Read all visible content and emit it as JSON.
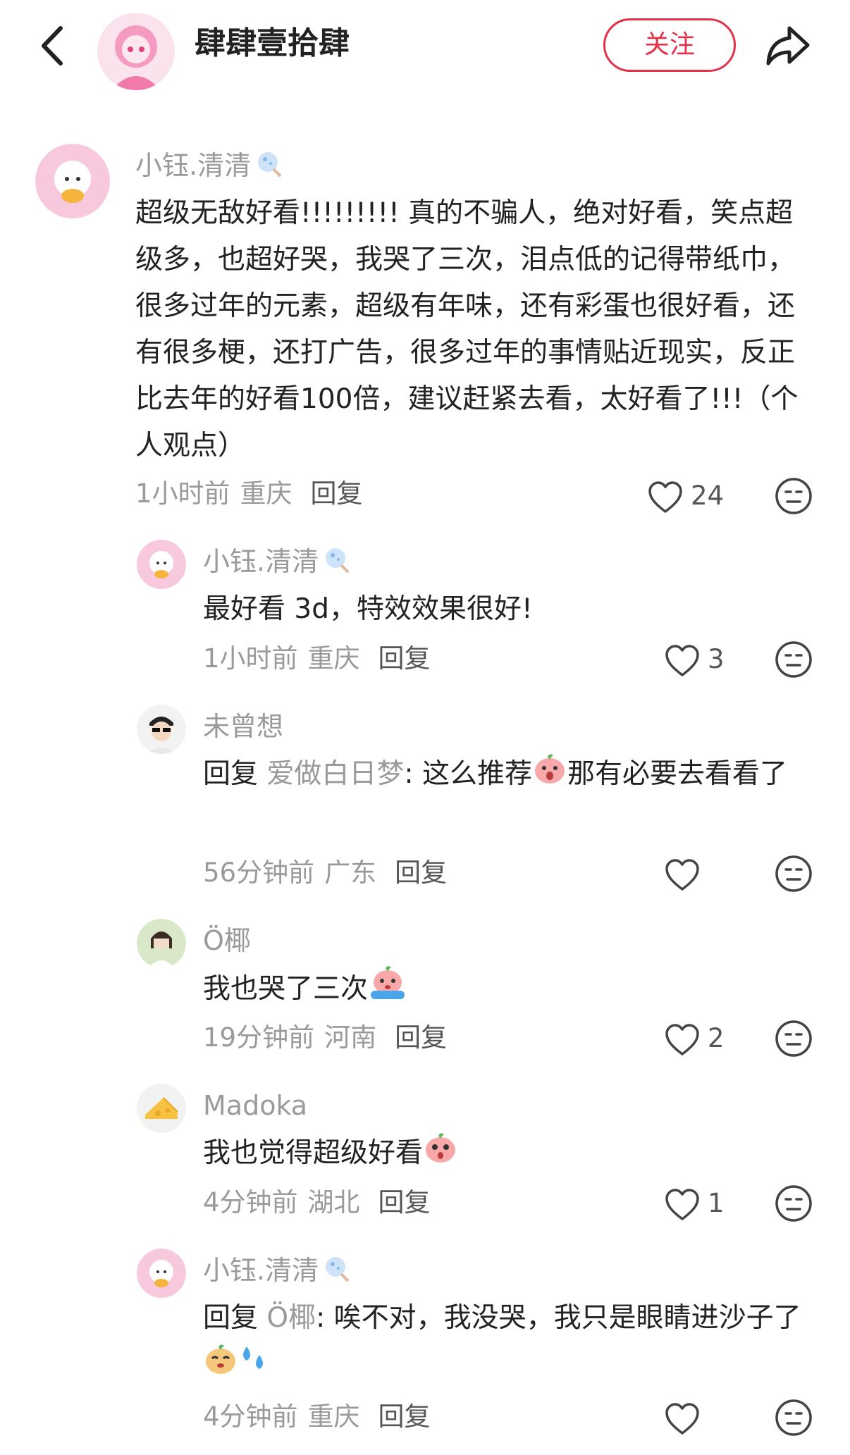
{
  "header": {
    "title": "肆肆壹拾肆",
    "follow_label": "关注"
  },
  "comments": [
    {
      "username": "小钰.清清",
      "text": "超级无敌好看!!!!!!!!! 真的不骗人，绝对好看，笑点超级多，也超好哭，我哭了三次，泪点低的记得带纸巾，很多过年的元素，超级有年味，还有彩蛋也很好看，还有很多梗，还打广告，很多过年的事情贴近现实，反正比去年的好看100倍，建议赶紧去看，太好看了!!!（个人观点）",
      "time": "1小时前",
      "location": "重庆",
      "reply_label": "回复",
      "likes": "24"
    },
    {
      "username": "小钰.清清",
      "text": "最好看 3d，特效效果很好!",
      "time": "1小时前",
      "location": "重庆",
      "reply_label": "回复",
      "likes": "3"
    },
    {
      "username": "未曾想",
      "reply_prefix": "回复",
      "reply_to": "爱做白日梦",
      "text_a": ": 这么推荐",
      "text_b": "那有必要去看看了",
      "time": "56分钟前",
      "location": "广东",
      "reply_label": "回复",
      "likes": ""
    },
    {
      "username": "Ö椰",
      "text": "我也哭了三次",
      "time": "19分钟前",
      "location": "河南",
      "reply_label": "回复",
      "likes": "2"
    },
    {
      "username": "Madoka",
      "text": "我也觉得超级好看",
      "time": "4分钟前",
      "location": "湖北",
      "reply_label": "回复",
      "likes": "1"
    },
    {
      "username": "小钰.清清",
      "reply_prefix": "回复",
      "reply_to": "Ö椰",
      "text_a": ": 唉不对，我没哭，我只是眼睛进沙子了",
      "time": "4分钟前",
      "location": "重庆",
      "reply_label": "回复",
      "likes": ""
    }
  ],
  "colors": {
    "accent": "#e4304a",
    "meta_gray": "#9a9a9a",
    "text": "#222222"
  },
  "icons": [
    "back-arrow-icon",
    "share-icon",
    "heart-icon",
    "dislike-face-icon",
    "sparkle-badge-icon"
  ]
}
